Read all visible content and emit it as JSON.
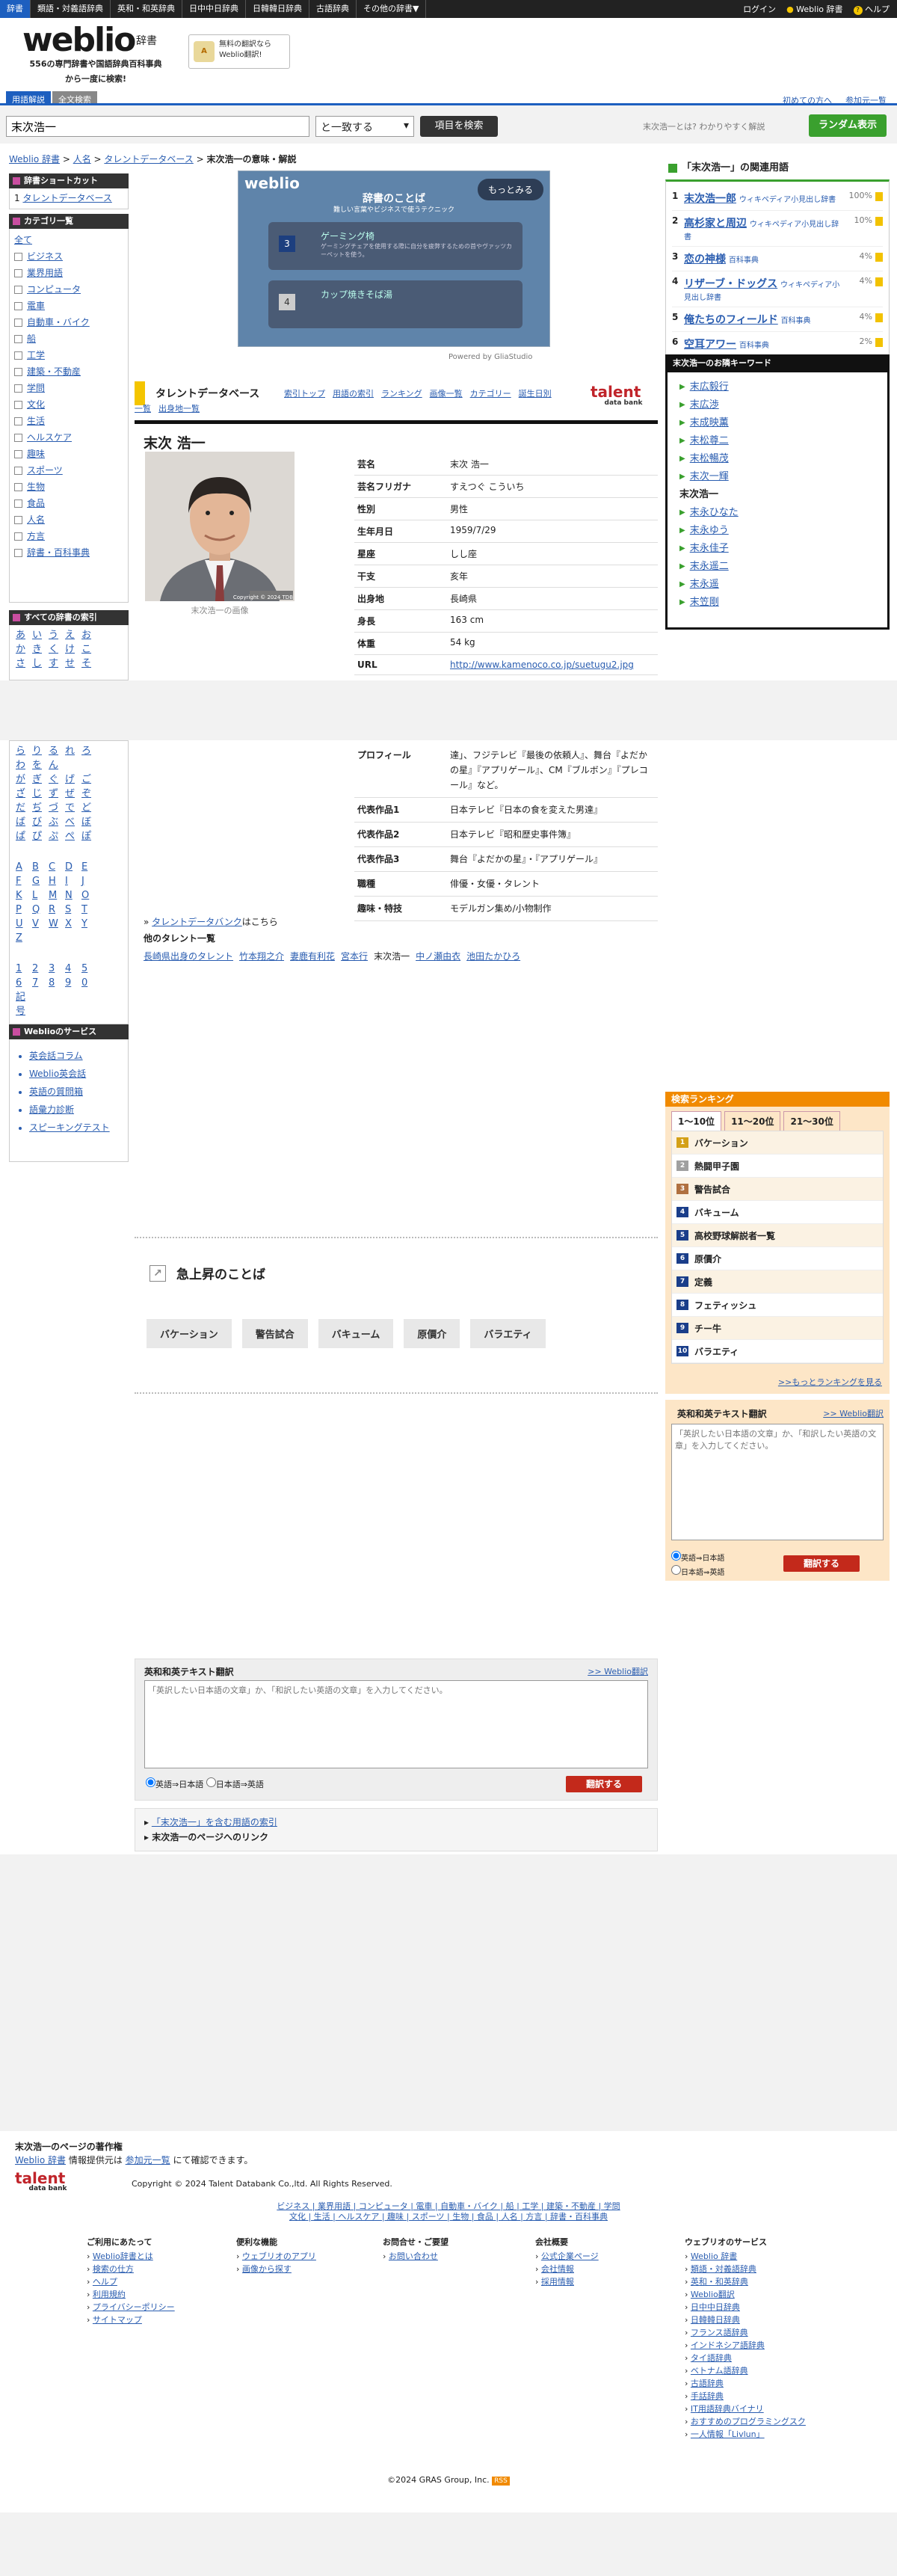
{
  "topbar": {
    "items": [
      "辞書",
      "類語・対義語辞典",
      "英和・和英辞典",
      "日中中日辞典",
      "日韓韓日辞典",
      "古語辞典",
      "その他の辞書▼"
    ],
    "login": "ログイン",
    "weblio": "Weblio 辞書",
    "help": "ヘルプ"
  },
  "header": {
    "logo": "weblio",
    "logo_sub": "辞書",
    "tagline1": "556の専門辞書や国語辞典百科事典",
    "tagline2": "から一度に検索!",
    "ad1": "無料の翻訳なら",
    "ad2": "Weblio翻訳!",
    "beginner": "初めての方へ",
    "join": "参加元一覧",
    "tab1": "用語解説",
    "tab2": "全文検索"
  },
  "search": {
    "value": "末次浩一",
    "match": "と一致する",
    "button": "項目を検索",
    "hint": "末次浩一とは? わかりやすく解説",
    "random": "ランダム表示"
  },
  "breadcrumb": {
    "home": "Weblio 辞書",
    "c1": "人名",
    "c2": "タレントデータベース",
    "current": "末次浩一の意味・解説"
  },
  "sidebar": {
    "shortcut_title": "辞書ショートカット",
    "shortcut_item": "タレントデータベース",
    "category_title": "カテゴリ一覧",
    "categories": [
      "全て",
      "ビジネス",
      "業界用語",
      "コンピュータ",
      "電車",
      "自動車・バイク",
      "船",
      "工学",
      "建築・不動産",
      "学問",
      "文化",
      "生活",
      "ヘルスケア",
      "趣味",
      "スポーツ",
      "生物",
      "食品",
      "人名",
      "方言",
      "辞書・百科事典"
    ],
    "kana_title": "すべての辞書の索引",
    "kana1": [
      "あ",
      "い",
      "う",
      "え",
      "お",
      "か",
      "き",
      "く",
      "け",
      "こ",
      "さ",
      "し",
      "す",
      "せ",
      "そ"
    ],
    "kana2": [
      "ら",
      "り",
      "る",
      "れ",
      "ろ",
      "わ",
      "を",
      "ん",
      "",
      "",
      "が",
      "ぎ",
      "ぐ",
      "げ",
      "ご",
      "ざ",
      "じ",
      "ず",
      "ぜ",
      "ぞ",
      "だ",
      "ぢ",
      "づ",
      "で",
      "ど",
      "ば",
      "び",
      "ぶ",
      "べ",
      "ぼ",
      "ぱ",
      "ぴ",
      "ぷ",
      "ぺ",
      "ぽ"
    ],
    "alpha": [
      "A",
      "B",
      "C",
      "D",
      "E",
      "F",
      "G",
      "H",
      "I",
      "J",
      "K",
      "L",
      "M",
      "N",
      "O",
      "P",
      "Q",
      "R",
      "S",
      "T",
      "U",
      "V",
      "W",
      "X",
      "Y",
      "Z"
    ],
    "nums": [
      "1",
      "2",
      "3",
      "4",
      "5",
      "6",
      "7",
      "8",
      "9",
      "0",
      "記号"
    ],
    "services_title": "Weblioのサービス",
    "services": [
      "英会話コラム",
      "Weblio英会話",
      "英語の質問箱",
      "語彙力診断",
      "スピーキングテスト"
    ]
  },
  "ad": {
    "title": "辞書のことば",
    "sub": "難しい言葉やビジネスで使うテクニック",
    "more": "もっとみる",
    "card1": "ゲーミング椅",
    "card1s": "ゲーミングチェアを使用する際に自分を疲弊するための首やヴァッツカーペットを使う。",
    "card2": "カップ焼きそば湯",
    "powered": "Powered by GliaStudio"
  },
  "tdb": {
    "title": "タレントデータベース",
    "links": [
      "索引トップ",
      "用語の索引",
      "ランキング",
      "画像一覧",
      "カテゴリー",
      "誕生日別"
    ],
    "links2": [
      "一覧",
      "出身地一覧"
    ],
    "logo1": "talent",
    "logo2": "data bank"
  },
  "profile": {
    "name": "末次 浩一",
    "photo_caption": "末次浩一の画像",
    "photo_credit": "Copyright © 2024 TDB",
    "rows": [
      {
        "k": "芸名",
        "v": "末次 浩一"
      },
      {
        "k": "芸名フリガナ",
        "v": "すえつぐ こういち"
      },
      {
        "k": "性別",
        "v": "男性"
      },
      {
        "k": "生年月日",
        "v": "1959/7/29"
      },
      {
        "k": "星座",
        "v": "しし座"
      },
      {
        "k": "干支",
        "v": "亥年"
      },
      {
        "k": "出身地",
        "v": "長崎県"
      },
      {
        "k": "身長",
        "v": "163 cm"
      },
      {
        "k": "体重",
        "v": "54 kg"
      },
      {
        "k": "URL",
        "v": "http://www.kamenoco.co.jp/suetugu2.jpg"
      }
    ],
    "profile_label": "プロフィール",
    "profile_text": "達」、フジテレビ『最後の依頼人』、舞台『よだかの星』『アプリゲール』、CM『ブルボン』『プレコール』など。",
    "rows2": [
      {
        "k": "代表作品1",
        "v": "日本テレビ『日本の食を変えた男達』"
      },
      {
        "k": "代表作品2",
        "v": "日本テレビ『昭和歴史事件簿』"
      },
      {
        "k": "代表作品3",
        "v": "舞台『よだかの星』・『アプリゲール』"
      },
      {
        "k": "職種",
        "v": "俳優・女優・タレント"
      },
      {
        "k": "趣味・特技",
        "v": "モデルガン集め/小物制作"
      }
    ],
    "bank_link": "タレントデータバンク",
    "bank_suffix": "はこちら",
    "other_title": "他のタレント一覧",
    "others": [
      "長崎県出身のタレント",
      "竹本翔之介",
      "妻鹿有利花",
      "宮本行",
      "末次浩一",
      "中ノ瀬由衣",
      "池田たかひろ"
    ]
  },
  "rise": {
    "title": "急上昇のことば",
    "words": [
      "バケーション",
      "警告試合",
      "バキューム",
      "原價介",
      "バラエティ"
    ]
  },
  "translate": {
    "title": "英和和英テキスト翻訳",
    "link": ">> Weblio翻訳",
    "placeholder": "「英訳したい日本語の文章」か、「和訳したい英語の文章」を入力してください。",
    "r1": "英語⇒日本語",
    "r2": "日本語⇒英語",
    "button": "翻訳する"
  },
  "related_links": {
    "l1": "「末次浩一」を含む用語の索引",
    "l2": "末次浩一のページへのリンク"
  },
  "related": {
    "title": "「末次浩一」の関連用語",
    "items": [
      {
        "n": "1",
        "w": "末次浩一郎",
        "s": "ウィキペディア小見出し辞書",
        "p": "100%"
      },
      {
        "n": "2",
        "w": "高杉家と周辺",
        "s": "ウィキペディア小見出し辞書",
        "p": "10%"
      },
      {
        "n": "3",
        "w": "恋の神様",
        "s": "百科事典",
        "p": "4%"
      },
      {
        "n": "4",
        "w": "リザーブ・ドッグス",
        "s": "ウィキペディア小見出し辞書",
        "p": "4%"
      },
      {
        "n": "5",
        "w": "俺たちのフィールド",
        "s": "百科事典",
        "p": "4%"
      },
      {
        "n": "6",
        "w": "空耳アワー",
        "s": "百科事典",
        "p": "2%"
      }
    ]
  },
  "keywords": {
    "title": "末次浩一のお隣キーワード",
    "items": [
      "末広毅行",
      "末広渉",
      "末成映薫",
      "末松尊二",
      "末松暢茂",
      "末次一輝",
      "末次浩一",
      "末永ひなた",
      "末永ゆう",
      "末永佳子",
      "末永遥二",
      "末永遥",
      "末笠剛"
    ],
    "current": "末次浩一"
  },
  "ranking": {
    "title": "検索ランキング",
    "tabs": [
      "1〜10位",
      "11〜20位",
      "21〜30位"
    ],
    "items": [
      "バケーション",
      "熱闘甲子園",
      "警告試合",
      "バキューム",
      "高校野球解説者一覧",
      "原價介",
      "定義",
      "フェティッシュ",
      "チー牛",
      "バラエティ"
    ],
    "more": ">>もっとランキングを見る"
  },
  "footer": {
    "copy_title": "末次浩一のページの著作権",
    "copy_text1": "Weblio 辞書",
    "copy_text2": "情報提供元は",
    "copy_text3": "参加元一覧",
    "copy_text4": "にて確認できます。",
    "tdb_copy": "Copyright © 2024 Talent Databank Co.,ltd. All Rights Reserved.",
    "cat_links1": "ビジネス | 業界用語 | コンピュータ | 電車 | 自動車・バイク | 船 | 工学 | 建築・不動産 | 学問",
    "cat_links2": "文化 | 生活 | ヘルスケア | 趣味 | スポーツ | 生物 | 食品 | 人名 | 方言 | 辞書・百科事典",
    "col1_title": "ご利用にあたって",
    "col1": [
      "Weblio辞書とは",
      "検索の仕方",
      "ヘルプ",
      "利用規約",
      "プライバシーポリシー",
      "サイトマップ"
    ],
    "col2_title": "便利な機能",
    "col2": [
      "ウェブリオのアプリ",
      "画像から探す"
    ],
    "col3_title": "お問合せ・ご要望",
    "col3": [
      "お問い合わせ"
    ],
    "col4_title": "会社概要",
    "col4": [
      "公式企業ページ",
      "会社情報",
      "採用情報"
    ],
    "col5_title": "ウェブリオのサービス",
    "col5": [
      "Weblio 辞書",
      "類語・対義語辞典",
      "英和・和英辞典",
      "Weblio翻訳",
      "日中中日辞典",
      "日韓韓日辞典",
      "フランス語辞典",
      "インドネシア語辞典",
      "タイ語辞典",
      "ベトナム語辞典",
      "古語辞典",
      "手話辞典",
      "IT用語辞典バイナリ",
      "おすすめのプログラミングスク",
      "一人情報「Livlun」"
    ],
    "bottom": "©2024 GRAS Group, Inc.",
    "rss": "RSS"
  }
}
